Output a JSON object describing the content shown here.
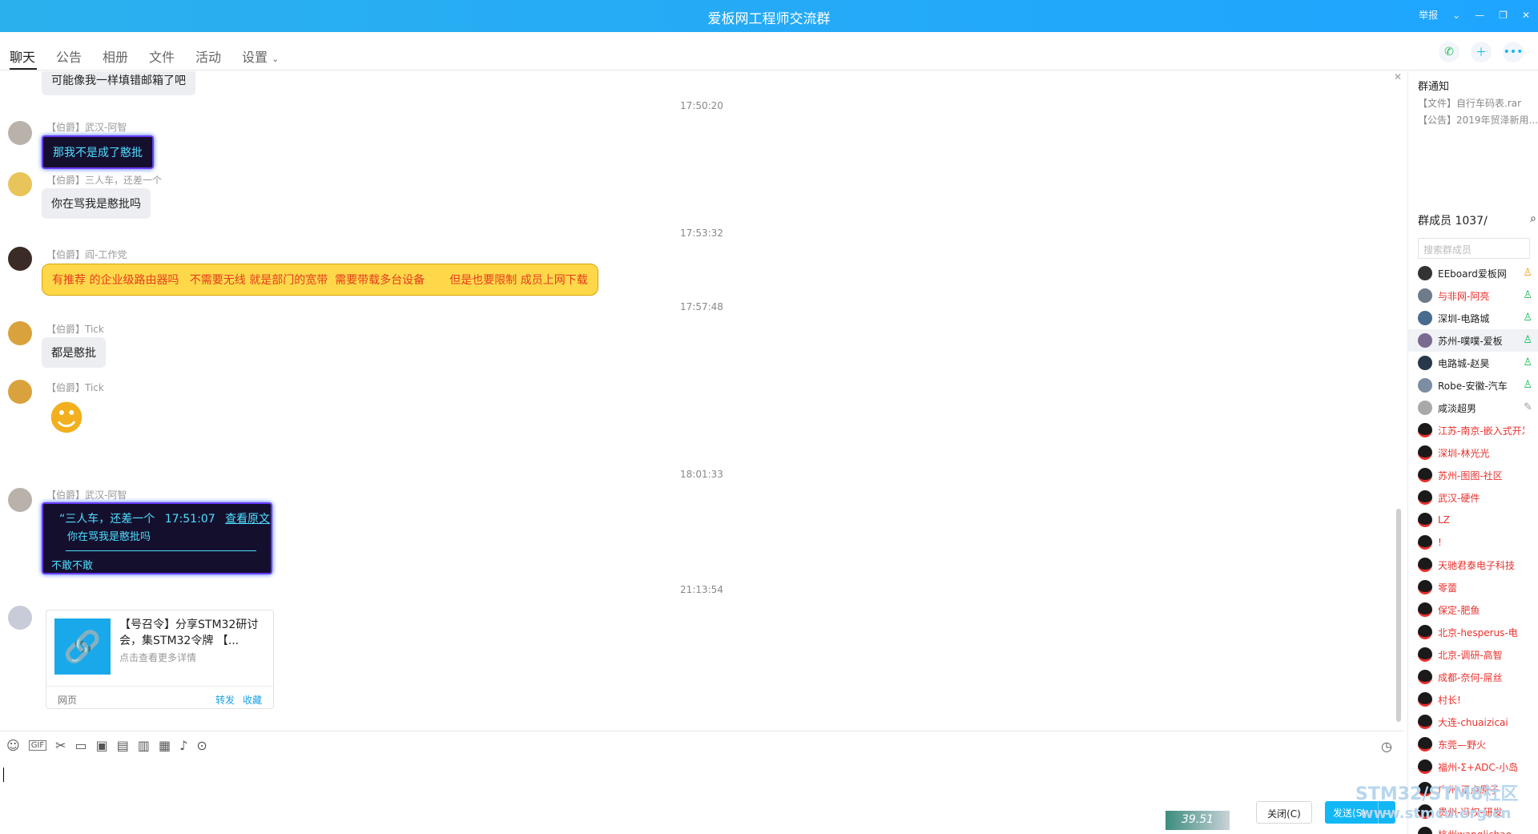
{
  "window": {
    "title": "爱板网工程师交流群",
    "report_label": "举报"
  },
  "tabs": [
    "聊天",
    "公告",
    "相册",
    "文件",
    "活动",
    "设置"
  ],
  "timestamps": [
    "17:50:20",
    "17:53:32",
    "17:57:48",
    "18:01:33",
    "21:13:54"
  ],
  "messages": {
    "partial_top": "可能像我一样填错邮箱了吧",
    "m1": {
      "nick": "【伯爵】武汉-阿智",
      "text": "那我不是成了憨批"
    },
    "m2": {
      "nick": "【伯爵】三人车，还差一个",
      "text": "你在骂我是憨批吗"
    },
    "m3": {
      "nick": "【伯爵】阎-工作党",
      "text": "有推荐 的企业级路由器吗   不需要无线 就是部门的宽带  需要带载多台设备       但是也要限制 成员上网下载"
    },
    "m4": {
      "nick": "【伯爵】Tick",
      "text": "都是憨批"
    },
    "m5": {
      "nick": "【伯爵】Tick"
    },
    "m6": {
      "nick": "【伯爵】武汉-阿智",
      "quote_author": "“三人车，还差一个",
      "quote_time": "17:51:07",
      "quote_link": "查看原文",
      "quote_text": "你在骂我是憨批吗",
      "text": "不敢不敢"
    },
    "card": {
      "title": "【号召令】分享STM32研讨会，集STM32令牌 【...",
      "subtitle": "点击查看更多详情",
      "source": "网页",
      "forward": "转发",
      "favorite": "收藏"
    }
  },
  "sidebar": {
    "notice_title": "群通知",
    "notices": [
      "【文件】自行车码表.rar",
      "【公告】2019年贸泽新用..."
    ],
    "members_title": "群成员 1037/",
    "search_placeholder": "搜索群成员",
    "members": [
      {
        "name": "EEboard爱板网",
        "color": "#222222",
        "badge": "owner"
      },
      {
        "name": "与非网-阿亮",
        "color": "#e8312d",
        "badge": "admin"
      },
      {
        "name": "深圳-电路城",
        "color": "#222222",
        "badge": "admin"
      },
      {
        "name": "苏州-噗噗-爱板",
        "color": "#222222",
        "badge": "admin"
      },
      {
        "name": "电路城-赵昊",
        "color": "#222222",
        "badge": "admin"
      },
      {
        "name": "Robe-安徽-汽车",
        "color": "#222222",
        "badge": "admin"
      },
      {
        "name": "咸淡超男",
        "color": "#222222",
        "badge": "edit"
      },
      {
        "name": "江苏-南京-嵌入式开发",
        "color": "#e8312d"
      },
      {
        "name": "深圳-林光光",
        "color": "#e8312d"
      },
      {
        "name": "苏州-图图-社区",
        "color": "#e8312d"
      },
      {
        "name": "武汉-硬件",
        "color": "#e8312d"
      },
      {
        "name": "LZ",
        "color": "#e8312d"
      },
      {
        "name": "!",
        "color": "#e8312d"
      },
      {
        "name": "天驰君泰电子科技",
        "color": "#e8312d"
      },
      {
        "name": "零蕾",
        "color": "#e8312d"
      },
      {
        "name": "保定-肥鱼",
        "color": "#e8312d"
      },
      {
        "name": "北京-hesperus-电",
        "color": "#e8312d"
      },
      {
        "name": "北京-调研-高智",
        "color": "#e8312d"
      },
      {
        "name": "成都-奈何-屌丝",
        "color": "#e8312d"
      },
      {
        "name": "村长!",
        "color": "#e8312d"
      },
      {
        "name": "大连-chuaizicai",
        "color": "#e8312d"
      },
      {
        "name": "东莞—野火",
        "color": "#e8312d"
      },
      {
        "name": "福州-Σ+ADC-小岛",
        "color": "#e8312d"
      },
      {
        "name": "广州-正点原子",
        "color": "#e8312d"
      },
      {
        "name": "贵州-冯权-研发",
        "color": "#e8312d"
      },
      {
        "name": "杭州wanglichao",
        "color": "#e8312d"
      }
    ]
  },
  "input": {
    "meter_value": "39.51",
    "close_button": "关闭(C)",
    "send_button": "发送(S)"
  },
  "watermark": {
    "line1": "STM32/STM8社区",
    "line2": "www.stmcu.org.cn"
  },
  "colors": {
    "title_bar": "#1ea5ff",
    "accent": "#12b7f5"
  }
}
